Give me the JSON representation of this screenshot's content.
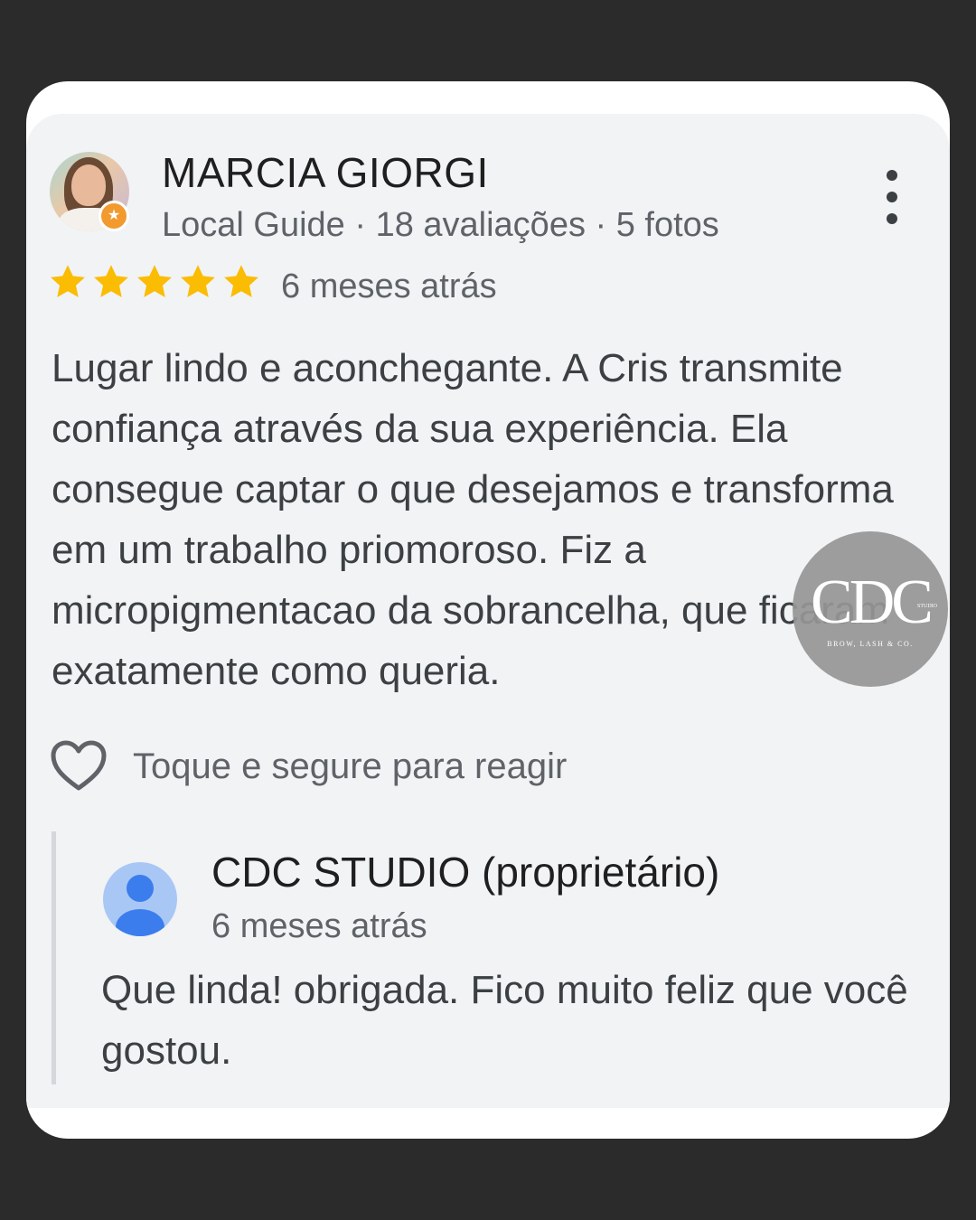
{
  "review": {
    "reviewer_name": "MARCIA GIORGI",
    "reviewer_meta": "Local Guide · 18 avaliações · 5 fotos",
    "rating": 5,
    "rating_max": 5,
    "time": "6 meses atrás",
    "text": "Lugar lindo e aconchegante. A Cris transmite confiança através da sua experiência. Ela consegue captar o que desejamos e transforma em um trabalho priomoroso. Fiz a micropigmentacao da sobrancelha, que ficaram exatamente como queria.",
    "react_label": "Toque e segure para reagir"
  },
  "reply": {
    "owner_name": "CDC STUDIO (proprietário)",
    "time": "6 meses atrás",
    "text": "Que linda! obrigada. Fico muito feliz que você gostou."
  },
  "watermark": {
    "main": "CDC",
    "studio": "STUDIO",
    "sub": "BROW, LASH & CO."
  },
  "colors": {
    "star": "#fbbc04",
    "background": "#2b2b2b",
    "card": "#f1f3f5",
    "owner_avatar": "#3b7ded"
  },
  "icons": {
    "more": "more-vertical-icon",
    "star": "star-icon",
    "heart": "heart-outline-icon",
    "guide_badge": "local-guide-star-icon"
  }
}
